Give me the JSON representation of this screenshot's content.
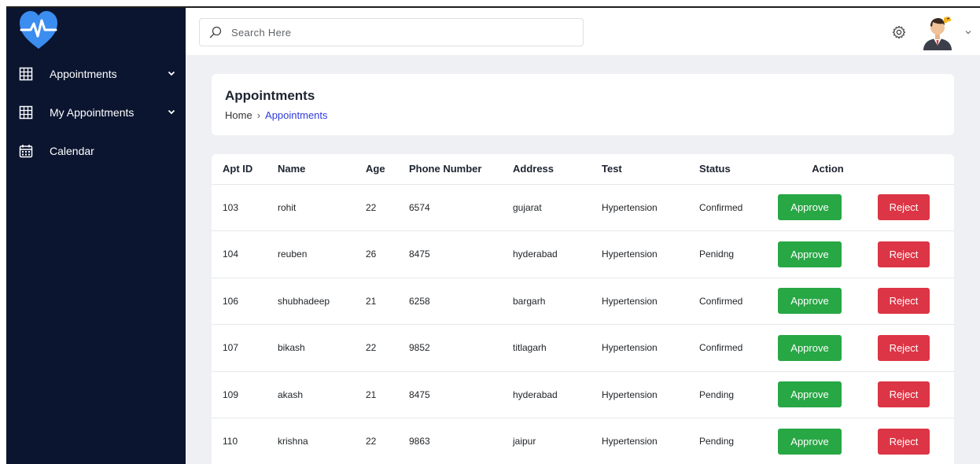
{
  "sidebar": {
    "items": [
      {
        "label": "Appointments",
        "icon": "table-grid-icon",
        "expandable": true
      },
      {
        "label": "My Appointments",
        "icon": "table-grid-icon",
        "expandable": true
      },
      {
        "label": "Calendar",
        "icon": "calendar-icon",
        "expandable": false
      }
    ]
  },
  "header": {
    "search_placeholder": "Search Here"
  },
  "page": {
    "title": "Appointments",
    "breadcrumb": {
      "home": "Home",
      "separator": "›",
      "current": "Appointments"
    }
  },
  "table": {
    "columns": [
      "Apt ID",
      "Name",
      "Age",
      "Phone Number",
      "Address",
      "Test",
      "Status",
      "Action"
    ],
    "approve_label": "Approve",
    "reject_label": "Reject",
    "rows": [
      {
        "id": "103",
        "name": "rohit",
        "age": "22",
        "phone": "6574",
        "address": "gujarat",
        "test": "Hypertension",
        "status": "Confirmed"
      },
      {
        "id": "104",
        "name": "reuben",
        "age": "26",
        "phone": "8475",
        "address": "hyderabad",
        "test": "Hypertension",
        "status": "Penidng"
      },
      {
        "id": "106",
        "name": "shubhadeep",
        "age": "21",
        "phone": "6258",
        "address": "bargarh",
        "test": "Hypertension",
        "status": "Confirmed"
      },
      {
        "id": "107",
        "name": "bikash",
        "age": "22",
        "phone": "9852",
        "address": "titlagarh",
        "test": "Hypertension",
        "status": "Confirmed"
      },
      {
        "id": "109",
        "name": "akash",
        "age": "21",
        "phone": "8475",
        "address": "hyderabad",
        "test": "Hypertension",
        "status": "Pending"
      },
      {
        "id": "110",
        "name": "krishna",
        "age": "22",
        "phone": "9863",
        "address": "jaipur",
        "test": "Hypertension",
        "status": "Pending"
      }
    ]
  },
  "colors": {
    "sidebar_bg": "#0b1530",
    "logo_blue": "#3b8df0",
    "approve": "#28a745",
    "reject": "#dc3545",
    "breadcrumb_active": "#2f3bd9",
    "main_bg": "#eef0f3"
  }
}
